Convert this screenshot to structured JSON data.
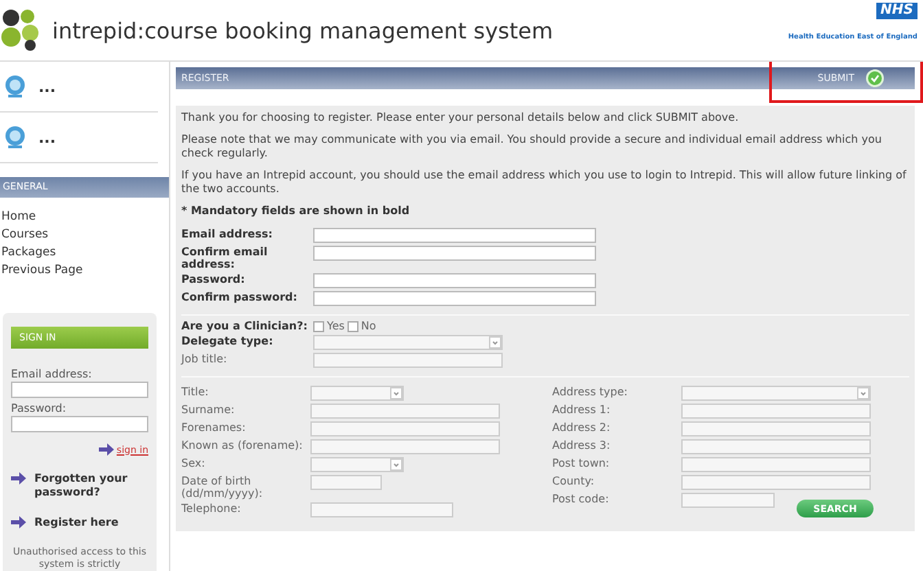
{
  "header": {
    "brand": "intrepid",
    "separator": ":",
    "title": "course booking management system",
    "badge": "NHS",
    "org": "Health Education East of England"
  },
  "sidebar": {
    "shortcuts": [
      {
        "label": "..."
      },
      {
        "label": "..."
      }
    ],
    "section_title": "GENERAL",
    "nav": [
      "Home",
      "Courses",
      "Packages",
      "Previous Page"
    ],
    "signin": {
      "title": "SIGN IN",
      "fields": [
        {
          "label": "Email address:"
        },
        {
          "label": "Password:"
        }
      ],
      "action": "sign in",
      "links": [
        "Forgotten your password?",
        "Register here"
      ],
      "notice": "Unauthorised access to this system is strictly"
    }
  },
  "panel": {
    "title": "REGISTER",
    "submit": "SUBMIT",
    "submit_highlighted": true,
    "intro": [
      "Thank you for choosing to register. Please enter your personal details below and click SUBMIT above.",
      "Please note that we may communicate with you via email. You should provide a secure and individual email address which you check regularly.",
      "If you have an Intrepid account, you should use the email address which you use to login to Intrepid. This will allow future linking of the two accounts."
    ],
    "mandatory_note": "* Mandatory fields are shown in bold",
    "account_fields": [
      {
        "label": "Email address:",
        "kind": "text",
        "bold": true
      },
      {
        "label": "Confirm email address:",
        "kind": "text",
        "bold": true
      },
      {
        "label": "Password:",
        "kind": "text",
        "bold": true
      },
      {
        "label": "Confirm password:",
        "kind": "text",
        "bold": true
      }
    ],
    "role_fields": [
      {
        "label": "Are you a Clinician?:",
        "kind": "radio",
        "bold": true,
        "options": [
          {
            "label": "Yes",
            "selected": false
          },
          {
            "label": "No",
            "selected": false
          }
        ]
      },
      {
        "label": "Delegate type:",
        "kind": "select",
        "bold": true
      },
      {
        "label": "Job title:",
        "kind": "text",
        "bold": false
      }
    ],
    "personal_fields": [
      {
        "label": "Title:",
        "kind": "select",
        "bold": false
      },
      {
        "label": "Surname:",
        "kind": "text",
        "bold": false
      },
      {
        "label": "Forenames:",
        "kind": "text",
        "bold": false
      },
      {
        "label": "Known as (forename):",
        "kind": "text",
        "bold": false
      },
      {
        "label": "Sex:",
        "kind": "select",
        "bold": false
      },
      {
        "label": "Date of birth (dd/mm/yyyy):",
        "kind": "date",
        "bold": false
      },
      {
        "label": "Telephone:",
        "kind": "phone",
        "bold": false
      }
    ],
    "address_fields": [
      {
        "label": "Address type:",
        "kind": "select",
        "bold": false
      },
      {
        "label": "Address 1:",
        "kind": "text",
        "bold": false
      },
      {
        "label": "Address 2:",
        "kind": "text",
        "bold": false
      },
      {
        "label": "Address 3:",
        "kind": "text",
        "bold": false
      },
      {
        "label": "Post town:",
        "kind": "text",
        "bold": false
      },
      {
        "label": "County:",
        "kind": "text",
        "bold": false
      },
      {
        "label": "Post code:",
        "kind": "postcode",
        "bold": false,
        "button": "SEARCH"
      }
    ]
  }
}
